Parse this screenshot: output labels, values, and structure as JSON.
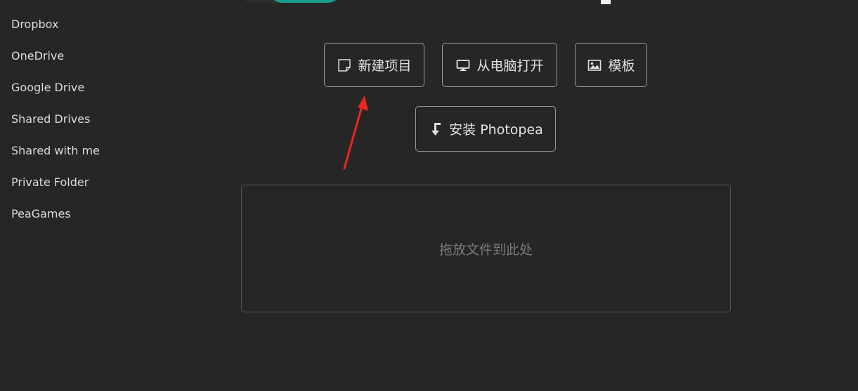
{
  "sidebar": {
    "items": [
      {
        "label": "Dropbox"
      },
      {
        "label": "OneDrive"
      },
      {
        "label": "Google Drive"
      },
      {
        "label": "Shared Drives"
      },
      {
        "label": "Shared with me"
      },
      {
        "label": "Private Folder"
      },
      {
        "label": "PeaGames"
      }
    ]
  },
  "actions": {
    "new_project": {
      "label": "新建项目",
      "icon": "new-file-icon"
    },
    "open_from_computer": {
      "label": "从电脑打开",
      "icon": "monitor-icon"
    },
    "templates": {
      "label": "模板",
      "icon": "image-icon"
    },
    "install": {
      "label": "安装 Photopea",
      "icon": "download-arrow-icon"
    }
  },
  "dropzone": {
    "text": "拖放文件到此处"
  },
  "colors": {
    "background": "#262626",
    "border": "#9a9a9a",
    "logo_accent": "#1a9e8c",
    "annotation": "#e8271e"
  }
}
